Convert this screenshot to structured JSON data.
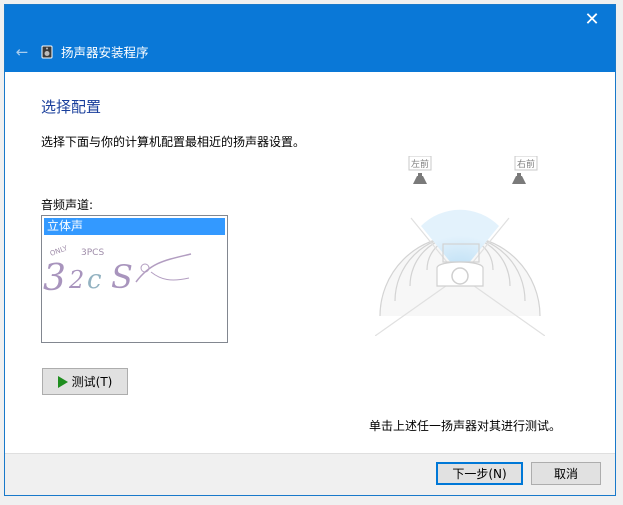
{
  "window": {
    "title": "扬声器安装程序",
    "close_glyph": "✕",
    "back_glyph": "←",
    "accent_color": "#0a78d7"
  },
  "main": {
    "heading": "选择配置",
    "instruction": "选择下面与你的计算机配置最相近的扬声器设置。",
    "channels_label": "音频声道:",
    "channels": [
      "立体声"
    ],
    "selected_channel": "立体声",
    "test_button_label": "测试(T)",
    "hint": "单击上述任一扬声器对其进行测试。"
  },
  "speakers": {
    "left_label": "左前",
    "right_label": "右前"
  },
  "footer": {
    "next_label": "下一步(N)",
    "cancel_label": "取消"
  },
  "watermark_text": "3PCS"
}
